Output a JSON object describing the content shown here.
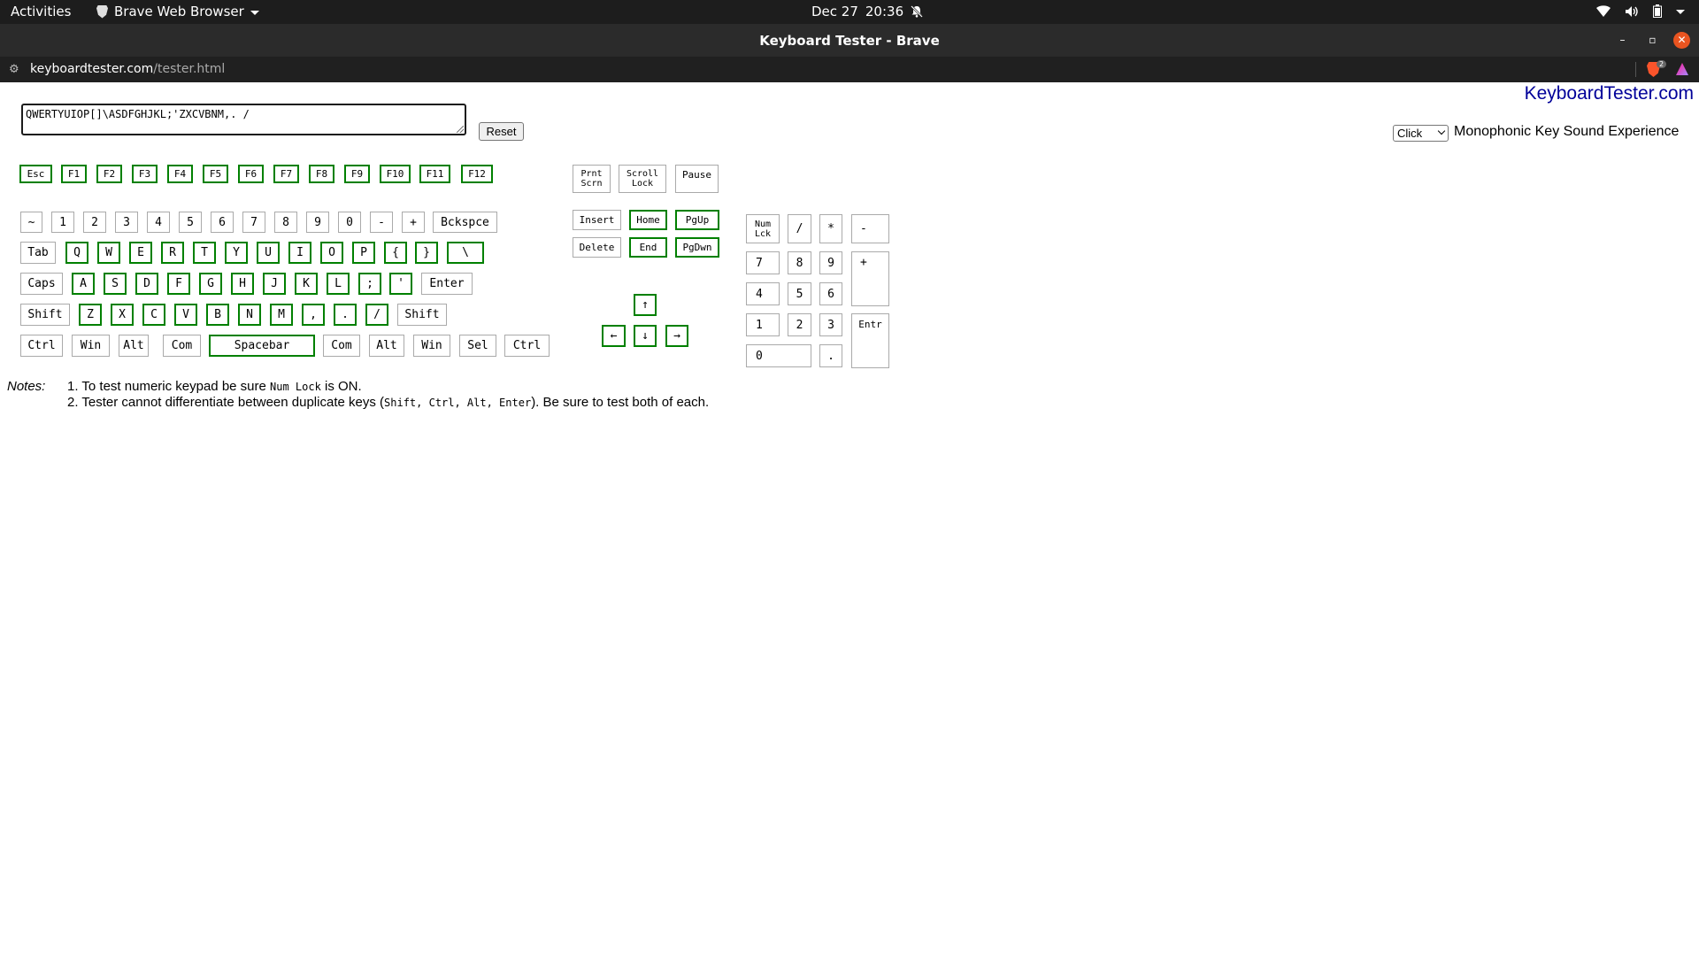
{
  "topbar": {
    "activities": "Activities",
    "app_name": "Brave Web Browser",
    "date": "Dec 27",
    "time": "20:36"
  },
  "window": {
    "title": "Keyboard Tester - Brave"
  },
  "urlbar": {
    "host": "keyboardtester.com",
    "path": "/tester.html",
    "shield_count": "2"
  },
  "page": {
    "brand": "KeyboardTester.com",
    "text_value": "QWERTYUIOP[]\\ASDFGHJKL;'ZXCVBNM,. /",
    "reset_label": "Reset",
    "sound_option": "Click",
    "sound_label": "Monophonic Key Sound Experience"
  },
  "keys": {
    "esc": "Esc",
    "f1": "F1",
    "f2": "F2",
    "f3": "F3",
    "f4": "F4",
    "f5": "F5",
    "f6": "F6",
    "f7": "F7",
    "f8": "F8",
    "f9": "F9",
    "f10": "F10",
    "f11": "F11",
    "f12": "F12",
    "prtscn_1": "Prnt",
    "prtscn_2": "Scrn",
    "scroll_1": "Scroll",
    "scroll_2": "Lock",
    "pause": "Pause",
    "tilde": "~",
    "k1": "1",
    "k2": "2",
    "k3": "3",
    "k4": "4",
    "k5": "5",
    "k6": "6",
    "k7": "7",
    "k8": "8",
    "k9": "9",
    "k0": "0",
    "minus": "-",
    "plus": "+",
    "backspace": "Bckspce",
    "tab": "Tab",
    "q": "Q",
    "w": "W",
    "e": "E",
    "r": "R",
    "t": "T",
    "y": "Y",
    "u": "U",
    "i": "I",
    "o": "O",
    "p": "P",
    "lbrace": "{",
    "rbrace": "}",
    "backslash": "\\",
    "caps": "Caps",
    "a": "A",
    "s": "S",
    "d": "D",
    "f": "F",
    "g": "G",
    "h": "H",
    "j": "J",
    "k": "K",
    "l": "L",
    "semicolon": ";",
    "quote": "'",
    "enter": "Enter",
    "lshift": "Shift",
    "z": "Z",
    "x": "X",
    "c": "C",
    "v": "V",
    "b": "B",
    "n": "N",
    "m": "M",
    "comma": ",",
    "period": ".",
    "slash": "/",
    "rshift": "Shift",
    "lctrl": "Ctrl",
    "lwin": "Win",
    "lalt": "Alt",
    "lcom": "Com",
    "space": "Spacebar",
    "rcom": "Com",
    "ralt": "Alt",
    "rwin": "Win",
    "sel": "Sel",
    "rctrl": "Ctrl",
    "insert": "Insert",
    "home": "Home",
    "pgup": "PgUp",
    "delete": "Delete",
    "end": "End",
    "pgdwn": "PgDwn",
    "up": "↑",
    "left": "←",
    "down": "↓",
    "right": "→",
    "numlck_1": "Num",
    "numlck_2": "Lck",
    "np_div": "/",
    "np_mul": "*",
    "np_sub": "-",
    "np7": "7",
    "np8": "8",
    "np9": "9",
    "np_add": "+",
    "np4": "4",
    "np5": "5",
    "np6": "6",
    "np1": "1",
    "np2": "2",
    "np3": "3",
    "np_enter": "Entr",
    "np0": "0",
    "np_dot": "."
  },
  "notes": {
    "label": "Notes:",
    "n1_pre": "1. To test numeric keypad be sure ",
    "n1_code": "Num Lock",
    "n1_post": " is ON.",
    "n2_pre": "2. Tester cannot differentiate between duplicate keys (",
    "n2_code": "Shift, Ctrl, Alt, Enter",
    "n2_post": "). Be sure to test both of each."
  }
}
